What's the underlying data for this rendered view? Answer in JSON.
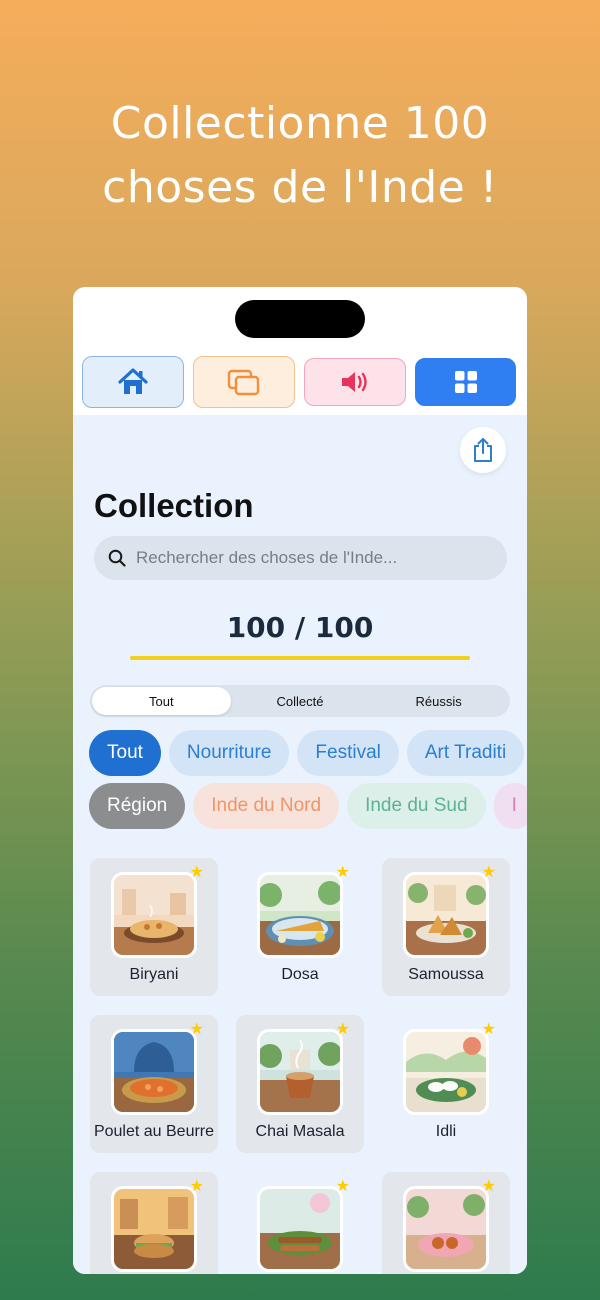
{
  "hero": {
    "line1": "Collectionne 100",
    "line2": "choses de l'Inde !"
  },
  "nav_tabs": [
    {
      "icon": "house-icon",
      "color": "#1f6fd0"
    },
    {
      "icon": "cards-icon",
      "color": "#f0903a"
    },
    {
      "icon": "speaker-icon",
      "color": "#e8335c"
    },
    {
      "icon": "grid-icon",
      "color": "#ffffff"
    }
  ],
  "page": {
    "title": "Collection",
    "search_placeholder": "Rechercher des choses de l'Inde...",
    "progress_text": "100 / 100",
    "progress_fraction": 1.0
  },
  "segments": [
    "Tout",
    "Collecté",
    "Réussis"
  ],
  "active_segment": "Tout",
  "category_chips": [
    "Tout",
    "Nourriture",
    "Festival",
    "Art Traditi"
  ],
  "region_chips": [
    "Région",
    "Inde du Nord",
    "Inde du Sud",
    "I"
  ],
  "items": [
    {
      "name": "Biryani",
      "starred": true
    },
    {
      "name": "Dosa",
      "starred": true
    },
    {
      "name": "Samoussa",
      "starred": true
    },
    {
      "name": "Poulet au Beurre",
      "starred": true
    },
    {
      "name": "Chai Masala",
      "starred": true
    },
    {
      "name": "Idli",
      "starred": true
    },
    {
      "name": "",
      "starred": true
    },
    {
      "name": "",
      "starred": true
    },
    {
      "name": "",
      "starred": true
    }
  ],
  "star_glyph": "★",
  "colors": {
    "accent": "#1f70d0",
    "progress": "#f2d11c",
    "star": "#ffcc00"
  }
}
